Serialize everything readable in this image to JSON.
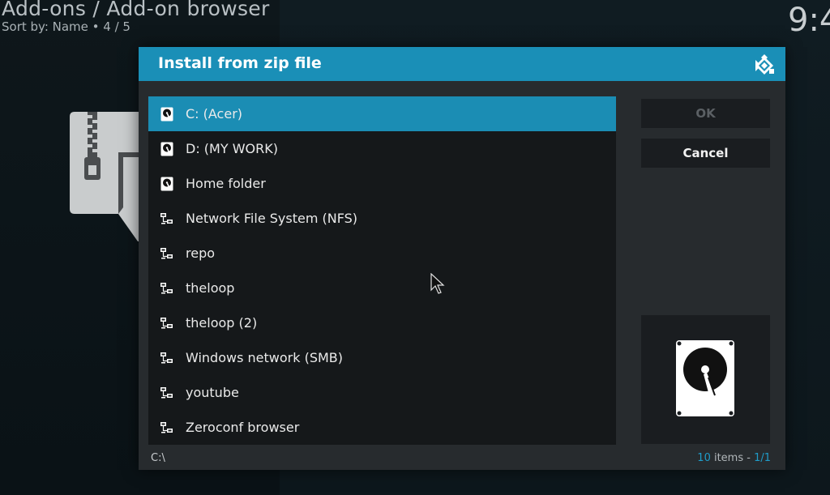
{
  "header": {
    "title": "Add-ons / Add-on browser",
    "subtitle": "Sort by: Name  •  4 / 5",
    "clock": "9:4"
  },
  "dialog": {
    "title": "Install from zip file",
    "buttons": {
      "ok": "OK",
      "cancel": "Cancel"
    },
    "path": "C:\\",
    "items": [
      {
        "label": "C: (Acer)",
        "icon": "hard-drive-icon",
        "selected": true
      },
      {
        "label": "D: (MY WORK)",
        "icon": "hard-drive-icon",
        "selected": false
      },
      {
        "label": "Home folder",
        "icon": "hard-drive-icon",
        "selected": false
      },
      {
        "label": "Network File System (NFS)",
        "icon": "network-icon",
        "selected": false
      },
      {
        "label": "repo",
        "icon": "network-icon",
        "selected": false
      },
      {
        "label": "theloop",
        "icon": "network-icon",
        "selected": false
      },
      {
        "label": "theloop (2)",
        "icon": "network-icon",
        "selected": false
      },
      {
        "label": "Windows network (SMB)",
        "icon": "network-icon",
        "selected": false
      },
      {
        "label": "youtube",
        "icon": "network-icon",
        "selected": false
      },
      {
        "label": "Zeroconf browser",
        "icon": "network-icon",
        "selected": false
      }
    ],
    "count": {
      "items": "10",
      "items_label": " items - ",
      "page": "1/1"
    }
  },
  "colors": {
    "accent": "#1a8fb7",
    "selected_row": "#1b8db4",
    "dialog_bg": "#272b2e",
    "list_bg": "#15181a"
  }
}
